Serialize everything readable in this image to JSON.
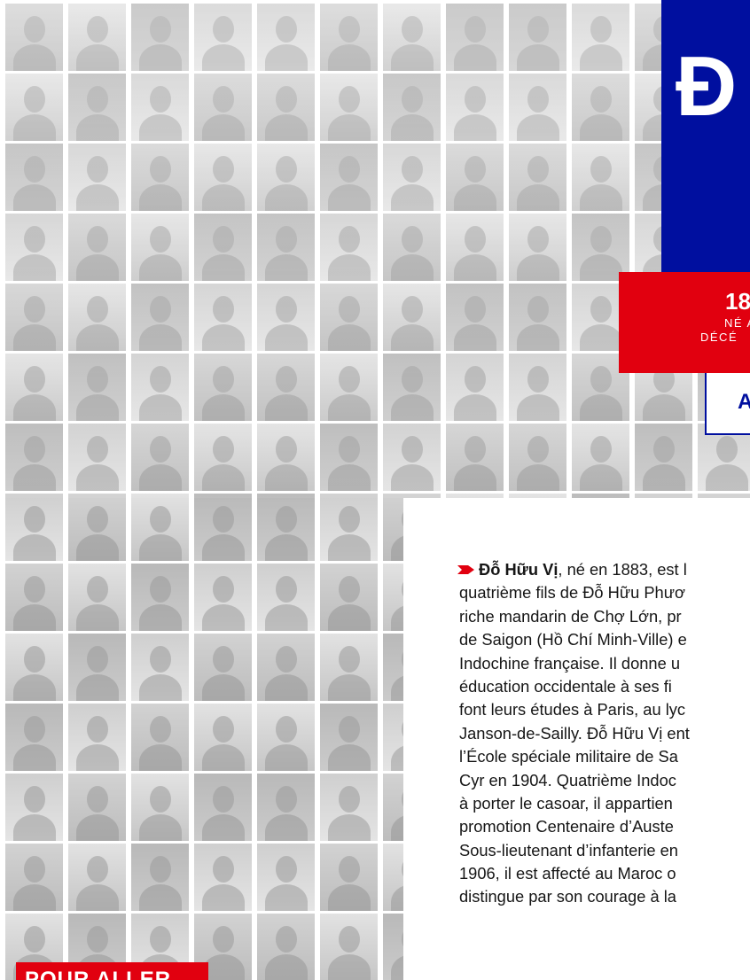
{
  "title": {
    "initial": "Đ"
  },
  "dates": {
    "years": "18",
    "born_line": "NÉ A",
    "died_line": "DÉCÉ"
  },
  "button": {
    "label": "A"
  },
  "article": {
    "name": "Đỗ Hữu Vị",
    "lines": [
      ", né en 1883, est l",
      "quatrième fils de Đỗ Hữu Phươ",
      "riche mandarin de Chợ Lớn, pr",
      "de Saigon (Hồ Chí Minh-Ville) e",
      "Indochine française. Il donne u",
      "éducation occidentale à ses fi",
      "font leurs études à Paris, au lyc",
      "Janson-de-Sailly. Đỗ Hữu Vị ent",
      "l’École spéciale militaire de Sa",
      "Cyr en 1904. Quatrième Indoc",
      "à porter le casoar, il appartien",
      "promotion Centenaire d’Auste",
      "Sous-lieutenant d’infanterie en",
      "1906, il est affecté au Maroc o",
      "distingue par son courage à la"
    ]
  },
  "footer": {
    "label": "POUR ALLER"
  },
  "colors": {
    "blue": "#000f9f",
    "red": "#e1000f",
    "text": "#161616"
  }
}
